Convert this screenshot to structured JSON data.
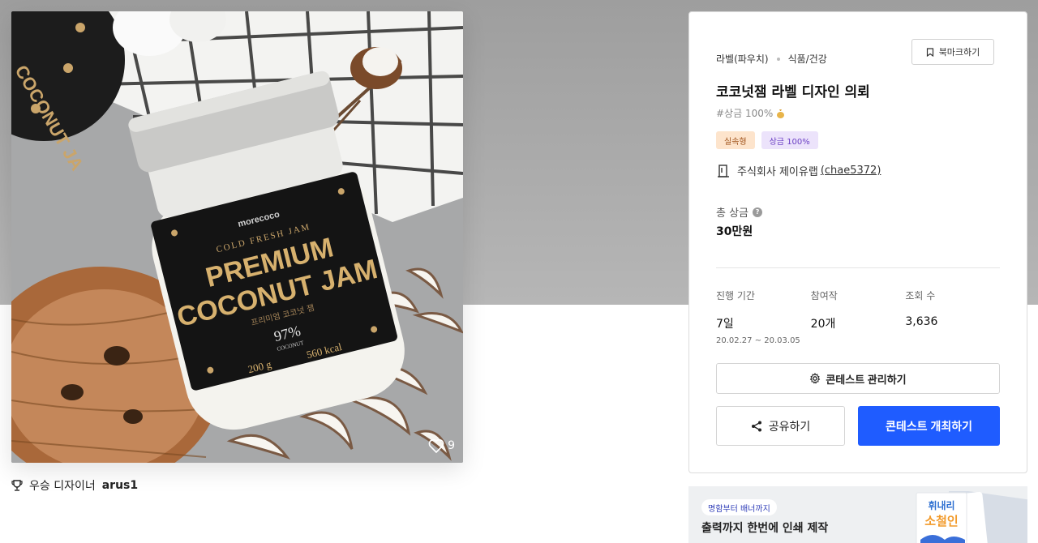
{
  "product": {
    "likes": "9",
    "winner_label": "우승 디자이너",
    "winner_name": "arus1",
    "jar": {
      "brand": "morecoco",
      "line1": "COLD FRESH JAM",
      "line2": "PREMIUM",
      "line3": "COCONUT JAM",
      "line4": "프리미엄 코코넛 잼",
      "percent": "97%",
      "coconut": "COCONUT",
      "weight": "200 g",
      "kcal": "560 kcal"
    }
  },
  "card": {
    "category_1": "라벨(파우치)",
    "category_2": "식품/건강",
    "bookmark_label": "북마크하기",
    "title": "코코넛잼 라벨 디자인 의뢰",
    "subtag": "#상금 100%",
    "badges": [
      "실속형",
      "상금 100%"
    ],
    "company_name": "주식회사 제이유랩",
    "company_handle": "(chae5372)",
    "prize_label": "총 상금",
    "prize_value": "30만원",
    "stats": [
      {
        "label": "진행 기간",
        "value": "7일",
        "sub": "20.02.27 ~ 20.03.05"
      },
      {
        "label": "참여작",
        "value": "20개",
        "sub": ""
      },
      {
        "label": "조회 수",
        "value": "3,636",
        "sub": ""
      }
    ],
    "manage_label": "콘테스트 관리하기",
    "share_label": "공유하기",
    "host_label": "콘테스트 개최하기"
  },
  "ad": {
    "pill": "명함부터 배너까지",
    "text": "출력까지 한번에 인쇄 제작",
    "art_text_1": "휘내리",
    "art_text_2": "소철인"
  },
  "colors": {
    "primary": "#1f5cff",
    "badge_orange_bg": "#fde4cc",
    "badge_purple_bg": "#ece3fb"
  }
}
